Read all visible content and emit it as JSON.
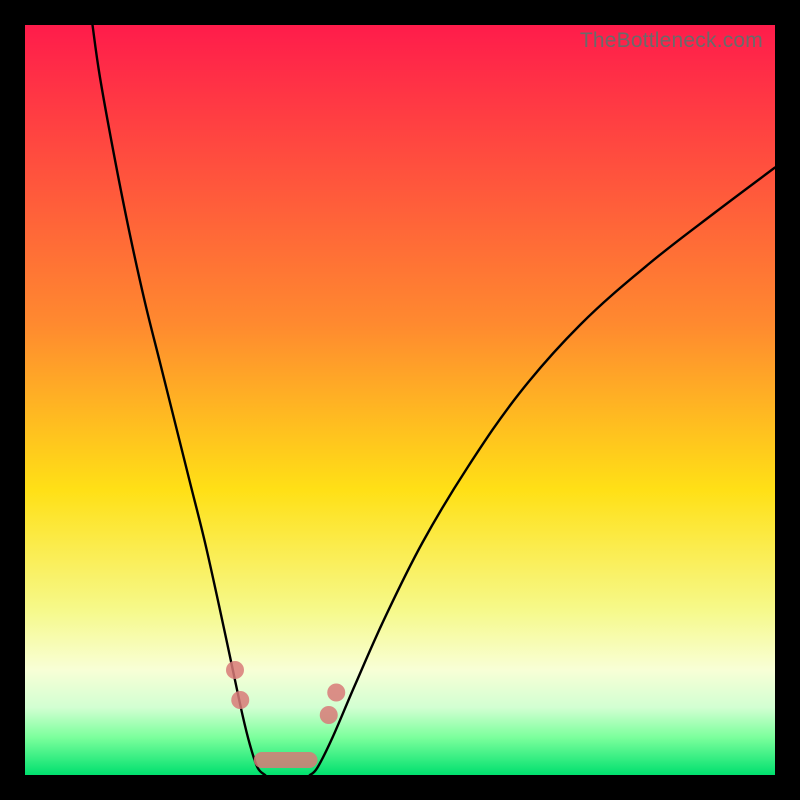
{
  "watermark": "TheBottleneck.com",
  "chart_data": {
    "type": "line",
    "title": "",
    "xlabel": "",
    "ylabel": "",
    "xlim": [
      0,
      100
    ],
    "ylim": [
      0,
      100
    ],
    "gradient_stops": [
      {
        "offset": 0,
        "color": "#ff1c4b"
      },
      {
        "offset": 40,
        "color": "#ff8a2f"
      },
      {
        "offset": 62,
        "color": "#ffe016"
      },
      {
        "offset": 78,
        "color": "#f6f98a"
      },
      {
        "offset": 86,
        "color": "#f8ffd6"
      },
      {
        "offset": 91,
        "color": "#d2ffd2"
      },
      {
        "offset": 95,
        "color": "#7bff9c"
      },
      {
        "offset": 100,
        "color": "#00e06e"
      }
    ],
    "series": [
      {
        "name": "left-curve",
        "x": [
          9,
          10,
          12,
          14,
          16,
          18,
          20,
          22,
          24,
          26,
          27.5,
          29,
          30,
          31,
          32
        ],
        "y": [
          100,
          93,
          82,
          72,
          63,
          55,
          47,
          39,
          31,
          22,
          15,
          8,
          4,
          1,
          0
        ]
      },
      {
        "name": "right-curve",
        "x": [
          38,
          39,
          41,
          44,
          48,
          53,
          59,
          66,
          74,
          83,
          92,
          100
        ],
        "y": [
          0,
          1,
          5,
          12,
          21,
          31,
          41,
          51,
          60,
          68,
          75,
          81
        ]
      },
      {
        "name": "valley-floor",
        "x": [
          32,
          33,
          34,
          35,
          36,
          37,
          38
        ],
        "y": [
          0,
          0,
          0,
          0,
          0,
          0,
          0
        ]
      }
    ],
    "markers": {
      "left_dots": [
        {
          "x": 28.0,
          "y": 14
        },
        {
          "x": 28.7,
          "y": 10
        }
      ],
      "right_dots": [
        {
          "x": 40.5,
          "y": 8
        },
        {
          "x": 41.5,
          "y": 11
        }
      ],
      "floor_bar": {
        "x0": 30.5,
        "x1": 39.0,
        "y": 2
      }
    }
  }
}
